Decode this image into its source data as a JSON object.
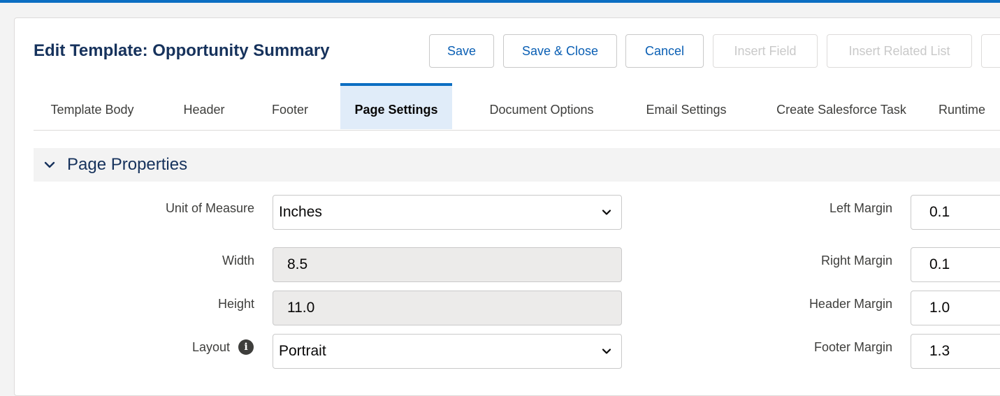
{
  "header": {
    "title": "Edit Template: Opportunity Summary"
  },
  "toolbar": {
    "save_label": "Save",
    "save_close_label": "Save & Close",
    "cancel_label": "Cancel",
    "insert_field_label": "Insert Field",
    "insert_related_list_label": "Insert Related List"
  },
  "tabs": [
    {
      "label": "Template Body",
      "active": false
    },
    {
      "label": "Header",
      "active": false
    },
    {
      "label": "Footer",
      "active": false
    },
    {
      "label": "Page Settings",
      "active": true
    },
    {
      "label": "Document Options",
      "active": false
    },
    {
      "label": "Email Settings",
      "active": false
    },
    {
      "label": "Create Salesforce Task",
      "active": false
    },
    {
      "label": "Runtime",
      "active": false
    }
  ],
  "section": {
    "title": "Page Properties",
    "icon": "chevron-down-icon"
  },
  "fields": {
    "unit_of_measure": {
      "label": "Unit of Measure",
      "value": "Inches"
    },
    "width": {
      "label": "Width",
      "value": "8.5"
    },
    "height": {
      "label": "Height",
      "value": "11.0"
    },
    "layout": {
      "label": "Layout",
      "value": "Portrait"
    },
    "left_margin": {
      "label": "Left Margin",
      "value": "0.1"
    },
    "right_margin": {
      "label": "Right Margin",
      "value": "0.1"
    },
    "header_margin": {
      "label": "Header Margin",
      "value": "1.0"
    },
    "footer_margin": {
      "label": "Footer Margin",
      "value": "1.3"
    }
  },
  "colors": {
    "brand": "#0b6ec2",
    "title": "#16325c",
    "button_text": "#0a5fb4",
    "active_tab_bg": "#e0ecf9"
  }
}
